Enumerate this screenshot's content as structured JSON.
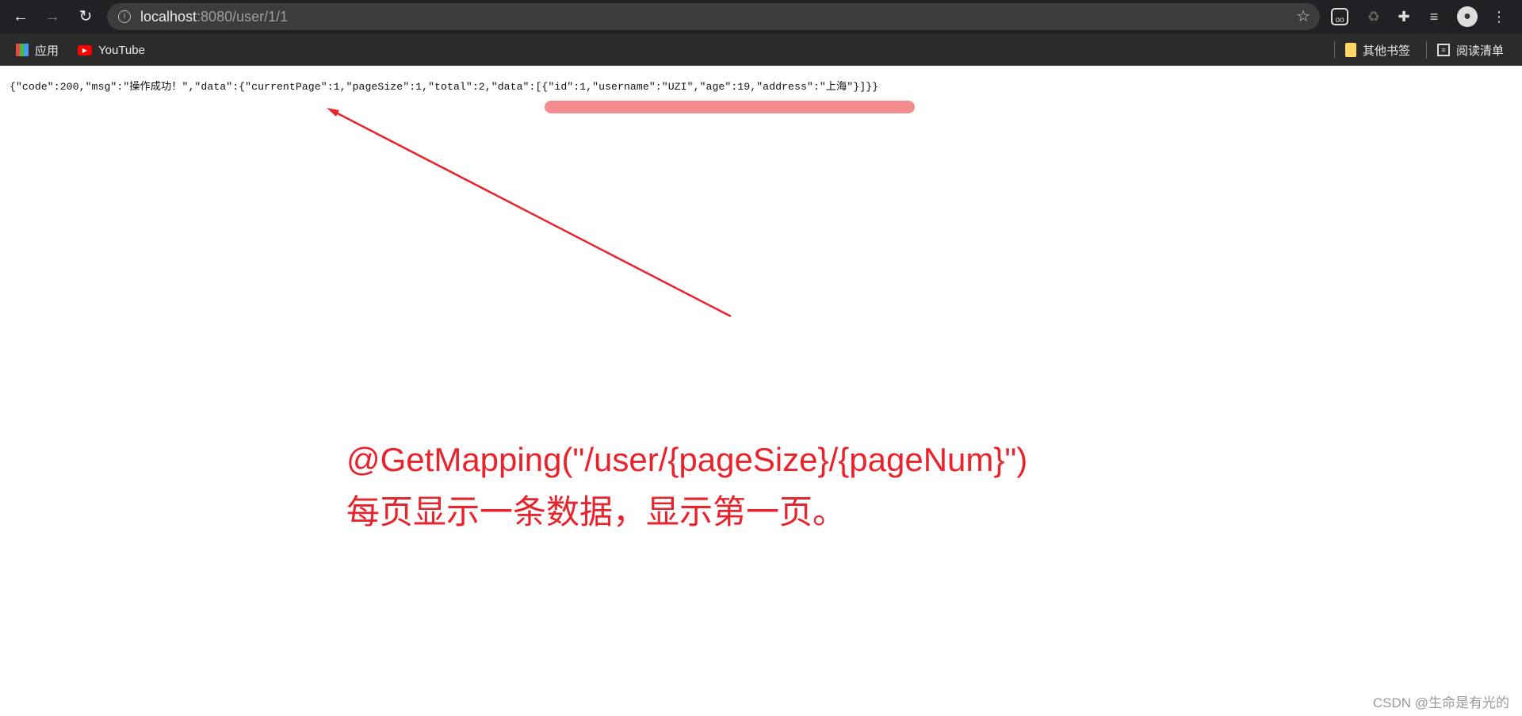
{
  "browser": {
    "url_host": "localhost",
    "url_rest": ":8080/user/1/1",
    "bookmarks": [
      {
        "label": "应用",
        "icon": "apps-grid-icon"
      },
      {
        "label": "YouTube",
        "icon": "youtube-icon"
      }
    ],
    "other_bookmarks": "其他书签",
    "reading_list": "阅读清单"
  },
  "page": {
    "json_text": "{\"code\":200,\"msg\":\"操作成功！\",\"data\":{\"currentPage\":1,\"pageSize\":1,\"total\":2,\"data\":[{\"id\":1,\"username\":\"UZI\",\"age\":19,\"address\":\"上海\"}]}}"
  },
  "annotation": {
    "line1": "@GetMapping(\"/user/{pageSize}/{pageNum}\")",
    "line2": "每页显示一条数据，显示第一页。",
    "color": "#e8232b",
    "highlight_color": "#f48b8f"
  },
  "watermark": "CSDN @生命是有光的"
}
